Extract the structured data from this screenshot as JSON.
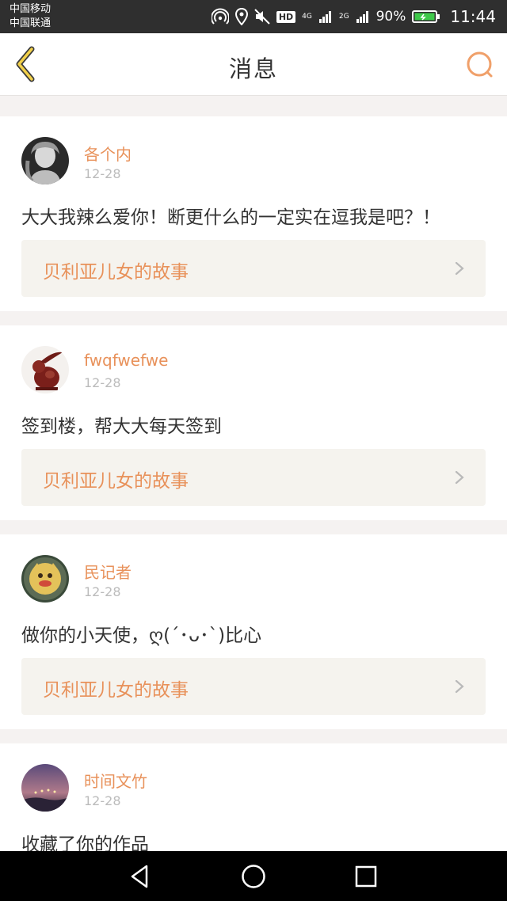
{
  "status_bar": {
    "carrier_1": "中国移动",
    "carrier_2": "中国联通",
    "network_1": "4G",
    "network_2": "2G",
    "hd_label": "HD",
    "battery": "90%",
    "time": "11:44",
    "battery_color": "#3ec94a"
  },
  "header": {
    "title": "消息",
    "back_icon": "back-chevron-icon",
    "search_icon": "search-icon",
    "accent": "#e8915a"
  },
  "messages": [
    {
      "username": "各个内",
      "date": "12-28",
      "text": "大大我辣么爱你！断更什么的一定实在逗我是吧？！",
      "story": "贝利亚儿女的故事"
    },
    {
      "username": "fwqfwefwe",
      "date": "12-28",
      "text": "签到楼，帮大大每天签到",
      "story": "贝利亚儿女的故事"
    },
    {
      "username": "民记者",
      "date": "12-28",
      "text": "做你的小天使，ღ(´･ᴗ･`)比心",
      "story": "贝利亚儿女的故事"
    },
    {
      "username": "时间文竹",
      "date": "12-28",
      "text": "收藏了你的作品"
    }
  ],
  "nav_bar": {
    "back_icon": "triangle-back-icon",
    "home_icon": "circle-home-icon",
    "recent_icon": "square-recents-icon"
  }
}
